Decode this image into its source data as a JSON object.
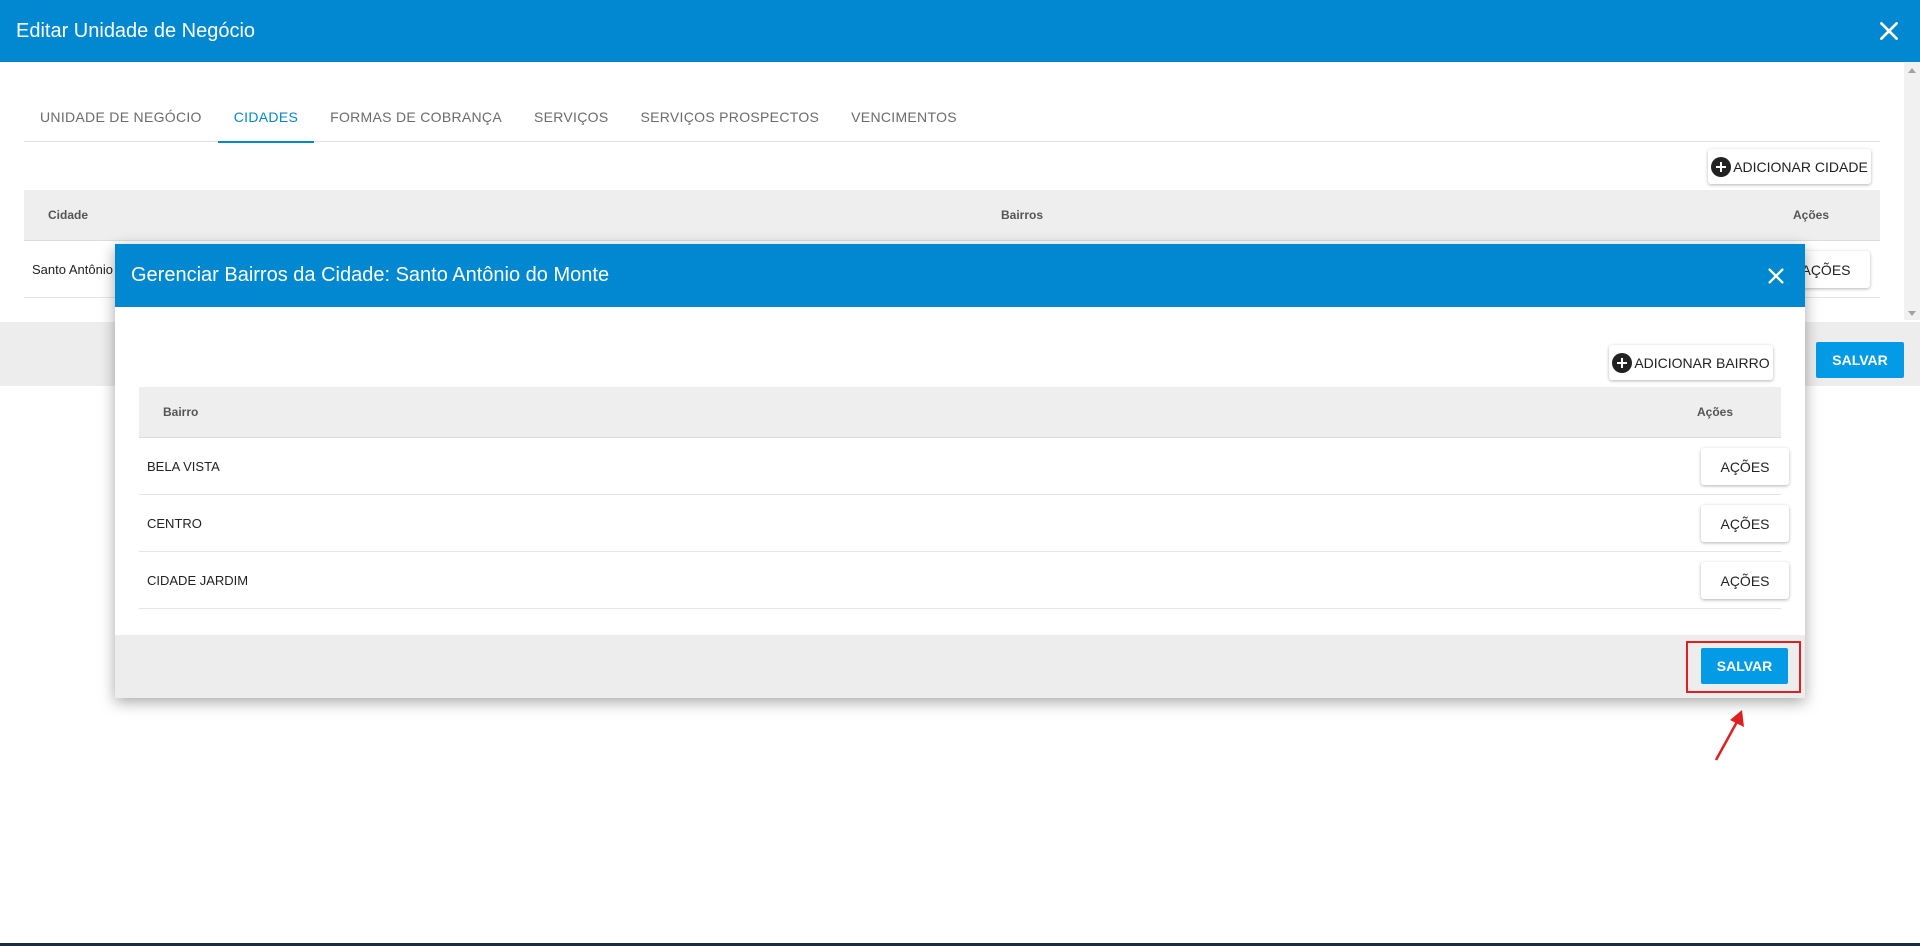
{
  "outer_dialog": {
    "title": "Editar Unidade de Negócio",
    "tabs": [
      {
        "label": "UNIDADE DE NEGÓCIO",
        "active": false
      },
      {
        "label": "CIDADES",
        "active": true
      },
      {
        "label": "FORMAS DE COBRANÇA",
        "active": false
      },
      {
        "label": "SERVIÇOS",
        "active": false
      },
      {
        "label": "SERVIÇOS PROSPECTOS",
        "active": false
      },
      {
        "label": "VENCIMENTOS",
        "active": false
      }
    ],
    "add_city_label": "ADICIONAR CIDADE",
    "table": {
      "headers": {
        "cidade": "Cidade",
        "bairros": "Bairros",
        "acoes": "Ações"
      },
      "rows": [
        {
          "cidade": "Santo Antônio",
          "acoes_label": "AÇÕES"
        }
      ]
    },
    "save_label": "SALVAR"
  },
  "inner_dialog": {
    "title": "Gerenciar Bairros da Cidade: Santo Antônio do Monte",
    "add_bairro_label": "ADICIONAR BAIRRO",
    "table": {
      "headers": {
        "bairro": "Bairro",
        "acoes": "Ações"
      },
      "rows": [
        {
          "bairro": "BELA VISTA",
          "acoes_label": "AÇÕES"
        },
        {
          "bairro": "CENTRO",
          "acoes_label": "AÇÕES"
        },
        {
          "bairro": "CIDADE JARDIM",
          "acoes_label": "AÇÕES"
        }
      ]
    },
    "save_label": "SALVAR"
  },
  "colors": {
    "header_blue": "#0288d1",
    "button_blue": "#039be5",
    "highlight_red": "#e02020"
  },
  "icons": [
    "close-icon",
    "plus-circle-icon",
    "arrow-annotation"
  ]
}
